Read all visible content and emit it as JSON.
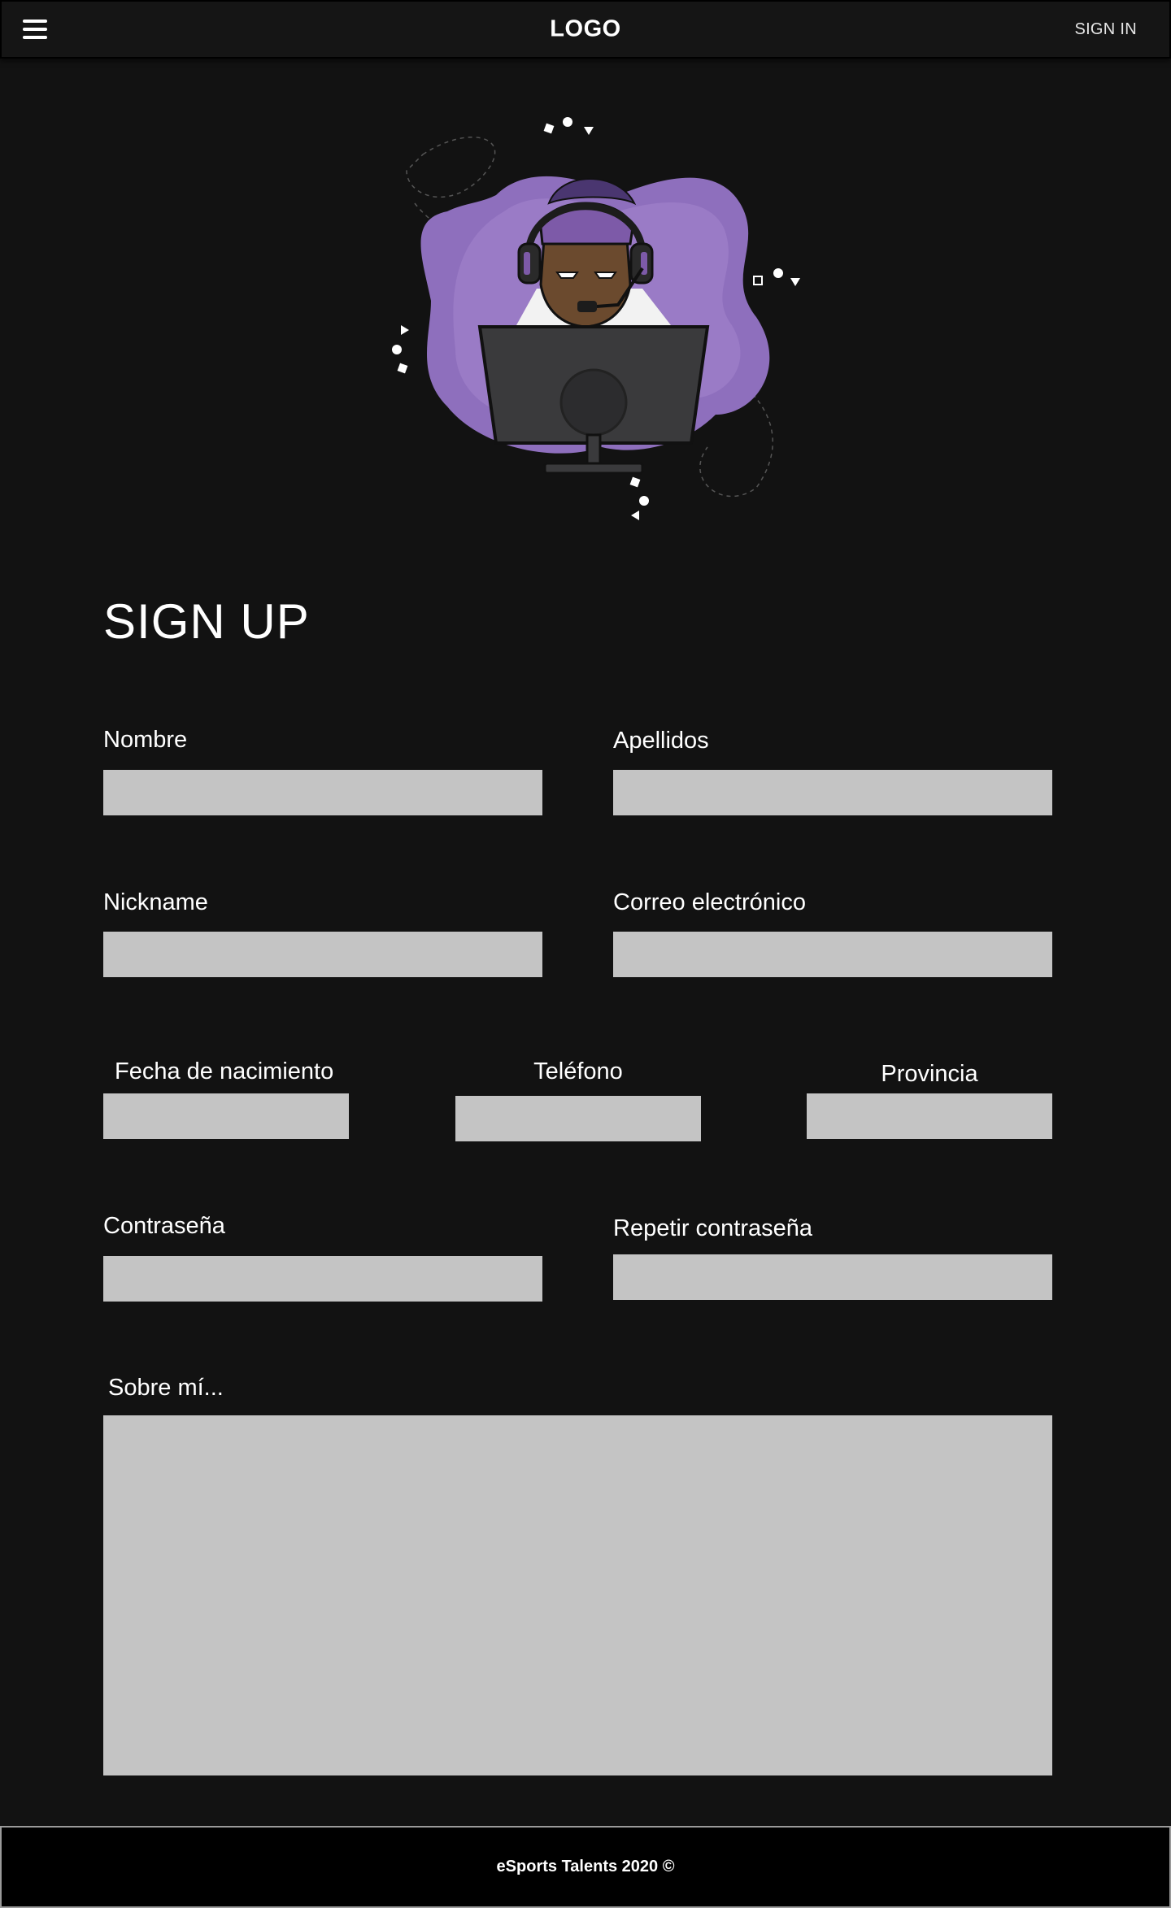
{
  "header": {
    "logo": "LOGO",
    "signin_label": "SIGN IN"
  },
  "icons": {
    "menu": "hamburger-menu-icon",
    "hero": "gamer-with-headset-illustration"
  },
  "colors": {
    "background": "#121212",
    "header": "#151515",
    "field": "#c4c4c4",
    "footer": "#000000",
    "accent_purple": "#8e6fbd"
  },
  "form": {
    "title": "SIGN UP",
    "nombre": {
      "label": "Nombre",
      "value": ""
    },
    "apellidos": {
      "label": "Apellidos",
      "value": ""
    },
    "nickname": {
      "label": "Nickname",
      "value": ""
    },
    "correo": {
      "label": "Correo electrónico",
      "value": ""
    },
    "fecha": {
      "label": "Fecha de nacimiento",
      "value": ""
    },
    "telefono": {
      "label": "Teléfono",
      "value": ""
    },
    "provincia": {
      "label": "Provincia",
      "value": ""
    },
    "contrasena": {
      "label": "Contraseña",
      "value": ""
    },
    "repetir": {
      "label": "Repetir contraseña",
      "value": ""
    },
    "sobre": {
      "label": "Sobre mí...",
      "value": ""
    }
  },
  "footer": {
    "text": "eSports Talents 2020 ©"
  }
}
